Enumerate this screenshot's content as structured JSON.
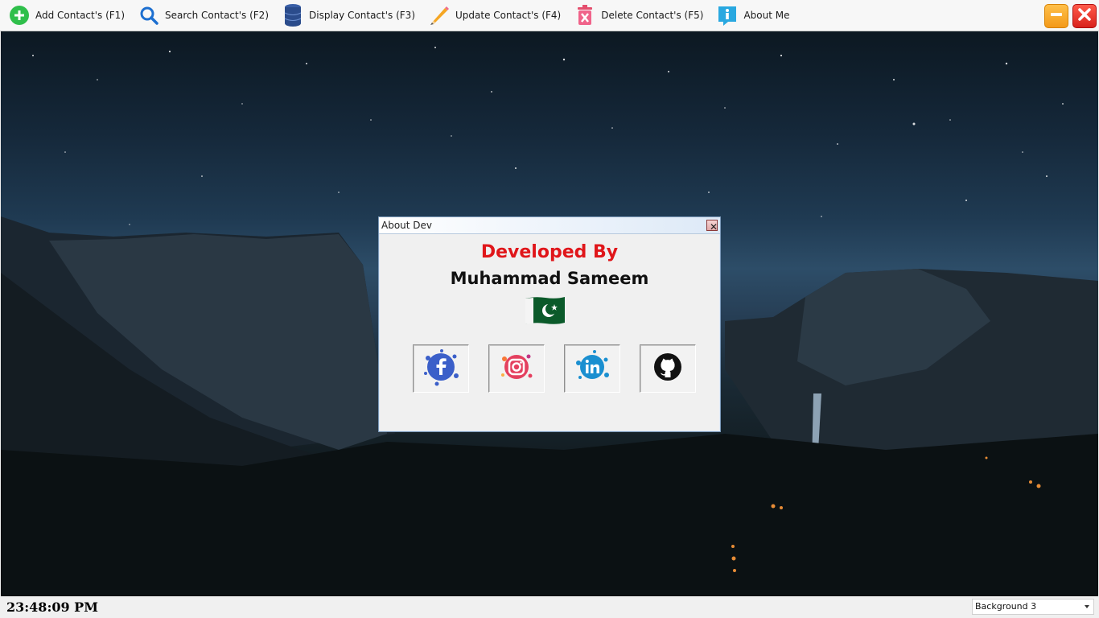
{
  "toolbar": {
    "items": [
      {
        "label": "Add Contact's (F1)",
        "icon": "add-icon"
      },
      {
        "label": "Search Contact's (F2)",
        "icon": "search-icon"
      },
      {
        "label": "Display Contact's (F3)",
        "icon": "database-icon"
      },
      {
        "label": "Update Contact's (F4)",
        "icon": "pencil-icon"
      },
      {
        "label": "Delete Contact's (F5)",
        "icon": "trash-icon"
      },
      {
        "label": "About Me",
        "icon": "info-icon"
      }
    ],
    "minimize_icon": "minimize-icon",
    "close_icon": "close-icon"
  },
  "dialog": {
    "title": "About Dev",
    "close_glyph": "✕",
    "developed_by": "Developed By",
    "developer_name": "Muhammad Sameem",
    "flag_icon": "pakistan-flag-icon",
    "social_buttons": [
      {
        "icon": "facebook-icon",
        "color": "#3b5fc9"
      },
      {
        "icon": "instagram-icon",
        "color": "#e4405f"
      },
      {
        "icon": "linkedin-icon",
        "color": "#1a8fd0"
      },
      {
        "icon": "github-icon",
        "color": "#111111"
      }
    ]
  },
  "status": {
    "time": "23:48:09 PM",
    "background_select": "Background 3"
  },
  "colors": {
    "accent_red": "#e0161a",
    "dialog_bg": "#f0f0f0"
  }
}
